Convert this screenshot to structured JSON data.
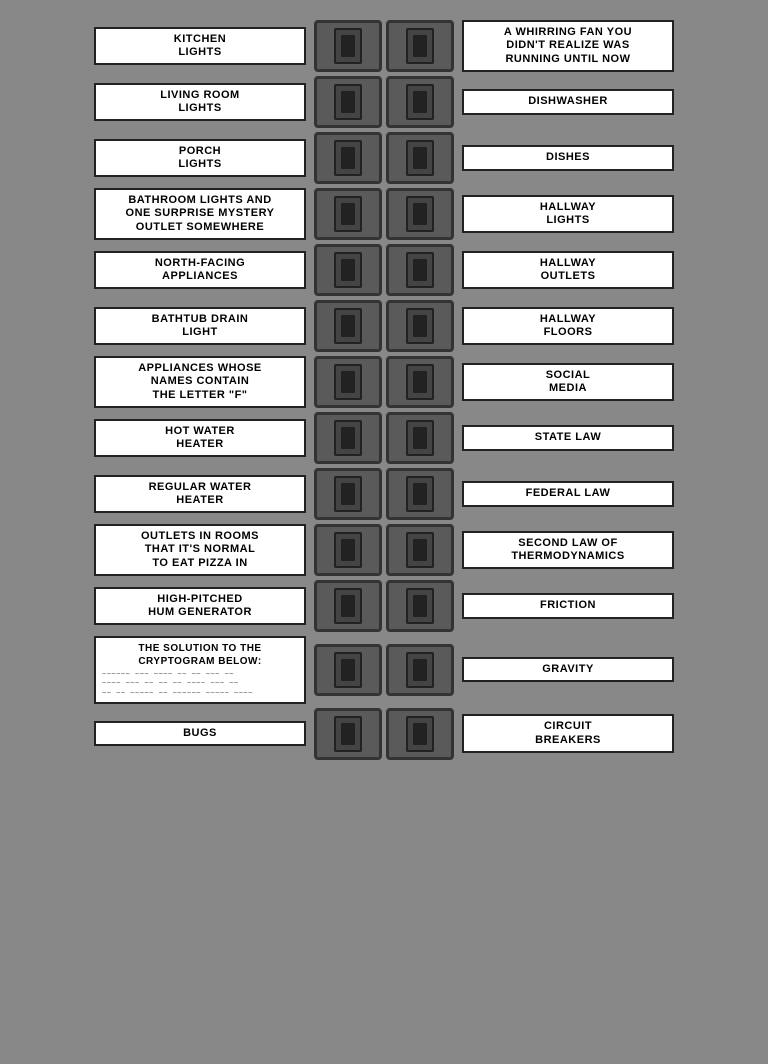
{
  "rows": [
    {
      "left": "KITCHEN\nLIGHTS",
      "right": "A WHIRRING FAN YOU\nDIDN'T REALIZE WAS\nRUNNING UNTIL NOW"
    },
    {
      "left": "LIVING ROOM\nLIGHTS",
      "right": "DISHWASHER"
    },
    {
      "left": "PORCH\nLIGHTS",
      "right": "DISHES"
    },
    {
      "left": "BATHROOM LIGHTS AND\nONE SURPRISE MYSTERY\nOUTLET SOMEWHERE",
      "right": "HALLWAY\nLIGHTS"
    },
    {
      "left": "NORTH-FACING\nAPPLIANCES",
      "right": "HALLWAY\nOUTLETS"
    },
    {
      "left": "BATHTUB DRAIN\nLIGHT",
      "right": "HALLWAY\nFLOORS"
    },
    {
      "left": "APPLIANCES WHOSE\nNAMES CONTAIN\nTHE LETTER \"F\"",
      "right": "SOCIAL\nMEDIA"
    },
    {
      "left": "HOT WATER\nHEATER",
      "right": "STATE LAW"
    },
    {
      "left": "REGULAR WATER\nHEATER",
      "right": "FEDERAL LAW"
    },
    {
      "left": "OUTLETS IN ROOMS\nTHAT IT'S NORMAL\nTO EAT PIZZA IN",
      "right": "SECOND LAW OF\nTHERMODYNAMICS"
    },
    {
      "left": "HIGH-PITCHED\nHUM GENERATOR",
      "right": "FRICTION"
    },
    {
      "left": "THE SOLUTION TO THE\nCRYPTOGRAM BELOW:",
      "right": "GRAVITY",
      "cryptogram": true
    },
    {
      "left": "BUGS",
      "right": "CIRCUIT\nBREAKERS"
    }
  ]
}
